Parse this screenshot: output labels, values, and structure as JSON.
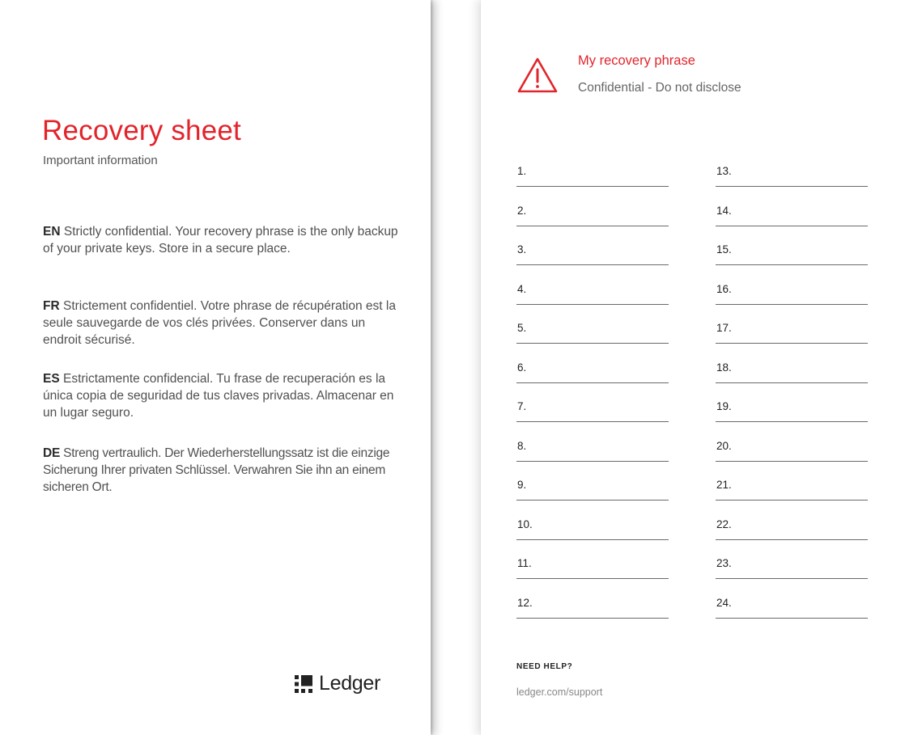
{
  "left_card": {
    "title": "Recovery sheet",
    "subtitle": "Important information",
    "notices": [
      {
        "lang": "EN",
        "text": "Strictly confidential. Your recovery phrase is the only backup of your private keys. Store in a secure place."
      },
      {
        "lang": "FR",
        "text": "Strictement confidentiel. Votre phrase de récupération est la seule sauvegarde de vos clés privées. Conserver dans un endroit sécurisé."
      },
      {
        "lang": "ES",
        "text": "Estrictamente confidencial. Tu frase de recuperación es la única copia de seguridad de tus claves privadas. Almacenar en un lugar seguro."
      },
      {
        "lang": "DE",
        "text": "Streng vertraulich. Der Wiederherstellungssatz ist die einzige Sicherung Ihrer privaten Schlüssel. Verwahren Sie ihn an einem sicheren Ort."
      }
    ],
    "logo": {
      "icon": "ledger-logo-icon",
      "text": "Ledger"
    }
  },
  "right_card": {
    "warning_icon": "warning-triangle-icon",
    "title": "My recovery phrase",
    "subtitle": "Confidential - Do not disclose",
    "column_a": [
      "1.",
      "2.",
      "3.",
      "4.",
      "5.",
      "6.",
      "7.",
      "8.",
      "9.",
      "10.",
      "11.",
      "12."
    ],
    "column_b": [
      "13.",
      "14.",
      "15.",
      "16.",
      "17.",
      "18.",
      "19.",
      "20.",
      "21.",
      "22.",
      "23.",
      "24."
    ],
    "help_title": "NEED HELP?",
    "help_link": "ledger.com/support"
  },
  "colors": {
    "accent": "#e2242b",
    "text": "#505050",
    "rule": "#6a6a6a"
  }
}
